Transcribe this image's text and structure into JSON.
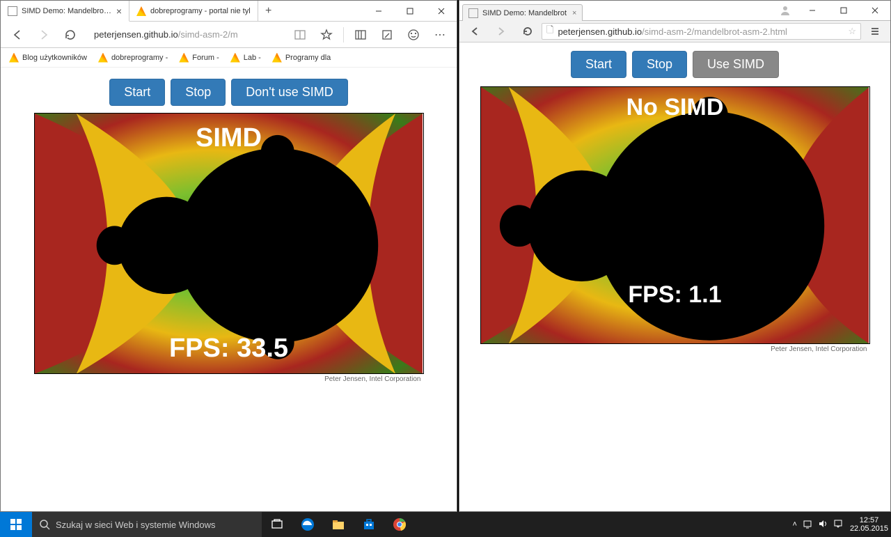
{
  "edge": {
    "tabs": [
      {
        "title": "SIMD Demo: Mandelbrot A"
      },
      {
        "title": "dobreprogramy - portal nie tyl"
      }
    ],
    "url_host": "peterjensen.github.io",
    "url_path": "/simd-asm-2/m",
    "bookmarks": [
      "Blog użytkowników",
      "dobreprogramy -",
      "Forum -",
      "Lab -",
      "Programy dla"
    ],
    "buttons": {
      "start": "Start",
      "stop": "Stop",
      "simd": "Don't use SIMD"
    },
    "overlay": {
      "label": "SIMD",
      "fps": "FPS: 33.5"
    },
    "attrib": "Peter Jensen, Intel Corporation"
  },
  "chrome": {
    "tab": "SIMD Demo: Mandelbrot",
    "url_host": "peterjensen.github.io",
    "url_path": "/simd-asm-2/mandelbrot-asm-2.html",
    "buttons": {
      "start": "Start",
      "stop": "Stop",
      "simd": "Use SIMD"
    },
    "overlay": {
      "label": "No SIMD",
      "fps": "FPS: 1.1"
    },
    "attrib": "Peter Jensen, Intel Corporation"
  },
  "taskbar": {
    "search": "Szukaj w sieci Web i systemie Windows",
    "time": "12:57",
    "date": "22.05.2015"
  }
}
